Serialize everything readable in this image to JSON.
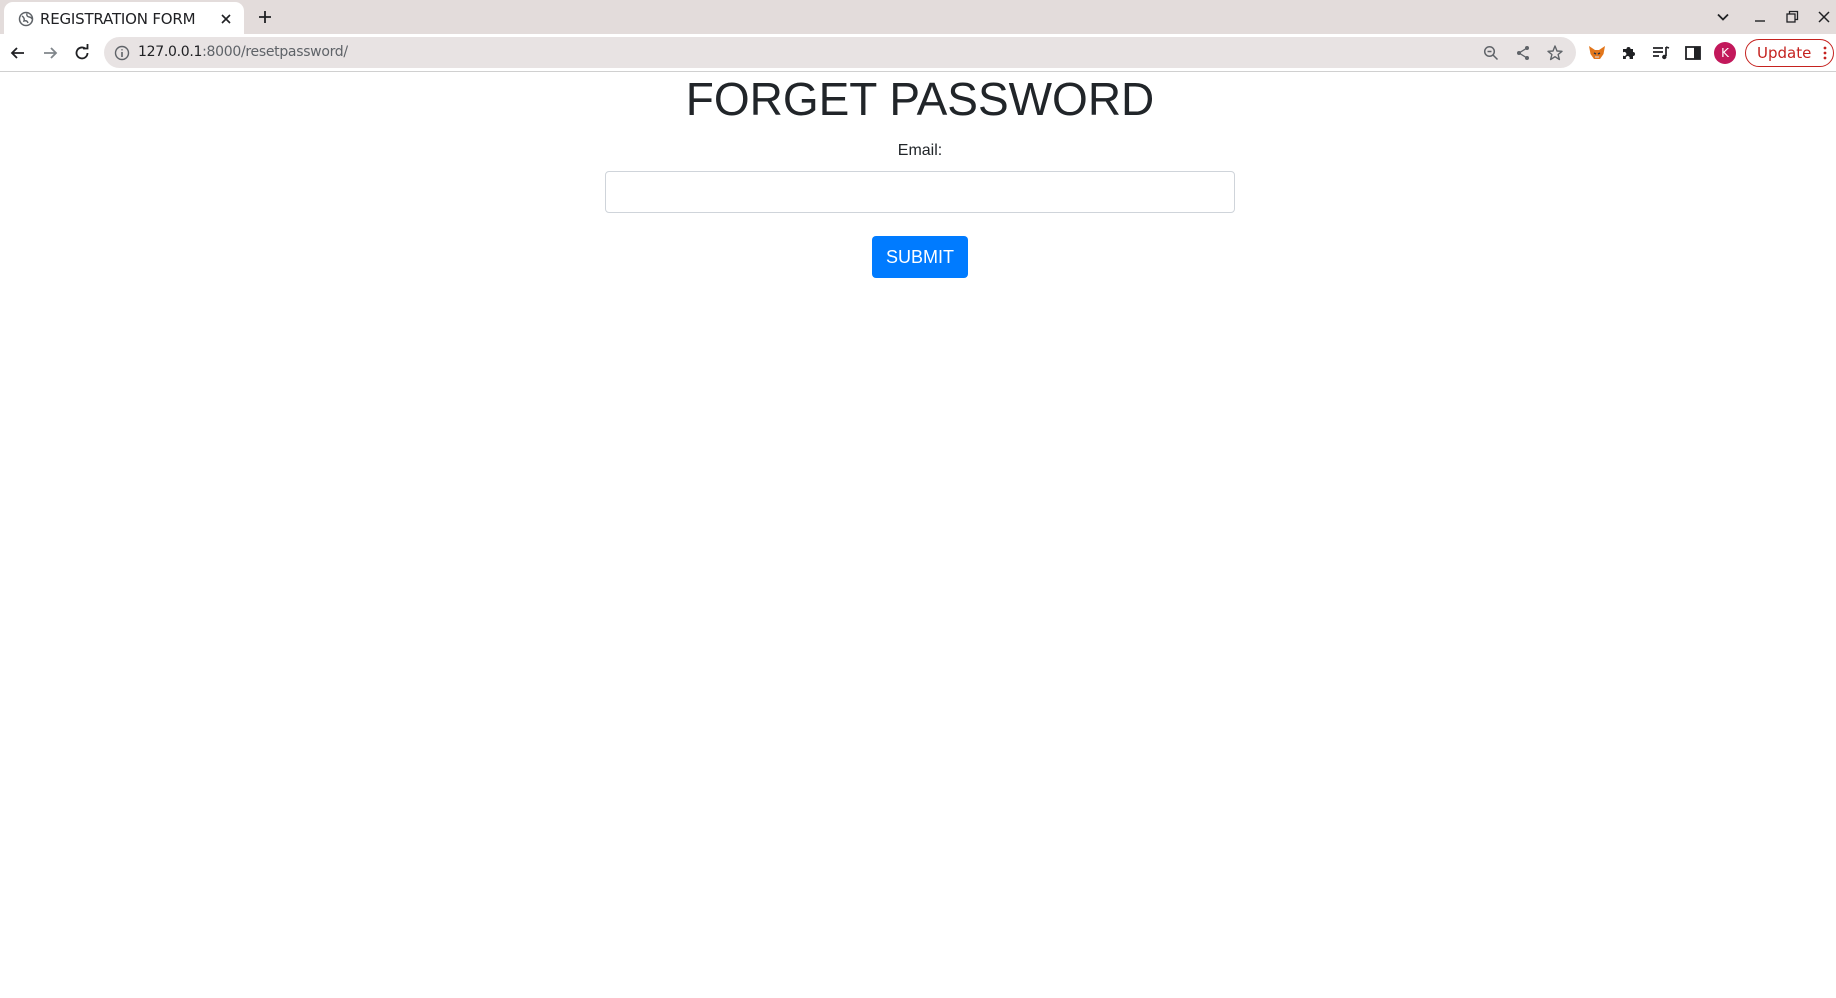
{
  "browser": {
    "tab_title": "REGISTRATION FORM",
    "url_host": "127.0.0.1",
    "url_rest": ":8000/resetpassword/",
    "avatar_letter": "K",
    "update_label": "Update",
    "icons": {
      "favicon": "globe-icon",
      "close": "close-icon",
      "new_tab": "plus-icon",
      "tab_search": "chevron-down-icon",
      "back": "arrow-left-icon",
      "forward": "arrow-right-icon",
      "reload": "reload-icon",
      "site_info": "info-icon",
      "zoom": "zoom-icon",
      "share": "share-icon",
      "bookmark": "star-icon",
      "extension_metamask": "fox-icon",
      "extensions": "puzzle-icon",
      "media": "media-control-icon",
      "side_panel": "side-panel-icon",
      "menu": "kebab-menu-icon"
    },
    "accent_color": "#c5221f"
  },
  "page": {
    "title": "FORGET PASSWORD",
    "email_label": "Email:",
    "email_value": "",
    "email_placeholder": "",
    "submit_label": "SUBMIT",
    "submit_color": "#007bff"
  }
}
